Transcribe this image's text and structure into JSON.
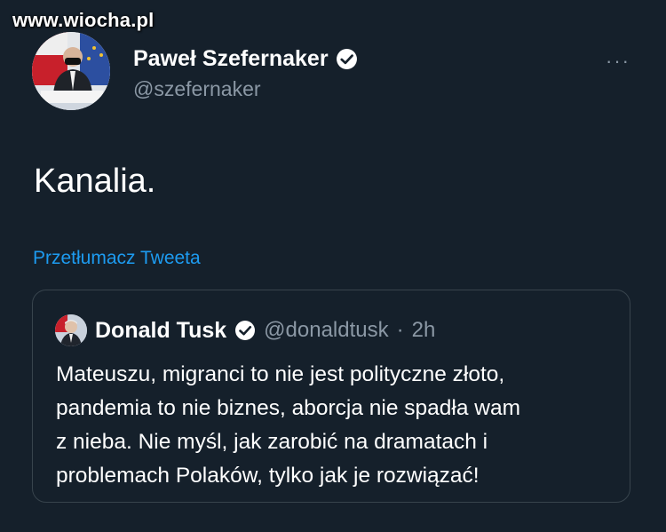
{
  "watermark": "www.wiocha.pl",
  "tweet": {
    "author_name": "Paweł Szefernaker",
    "author_handle": "@szefernaker",
    "text": "Kanalia.",
    "translate_label": "Przetłumacz Tweeta",
    "more_label": "···"
  },
  "quote": {
    "author_name": "Donald Tusk",
    "author_handle": "@donaldtusk",
    "separator": "·",
    "time": "2h",
    "lines": [
      "Mateuszu, migranci to nie jest polityczne złoto,",
      "pandemia to nie biznes, aborcja nie spadła wam",
      "z nieba. Nie myśl, jak zarobić na dramatach i",
      "problemach Polaków, tylko jak je rozwiązać!"
    ]
  },
  "colors": {
    "background": "#15202b",
    "link": "#1d9bf0",
    "secondary_text": "#8b98a5",
    "border": "#38444d"
  },
  "icons": [
    "verified-badge-icon",
    "more-options-icon"
  ]
}
